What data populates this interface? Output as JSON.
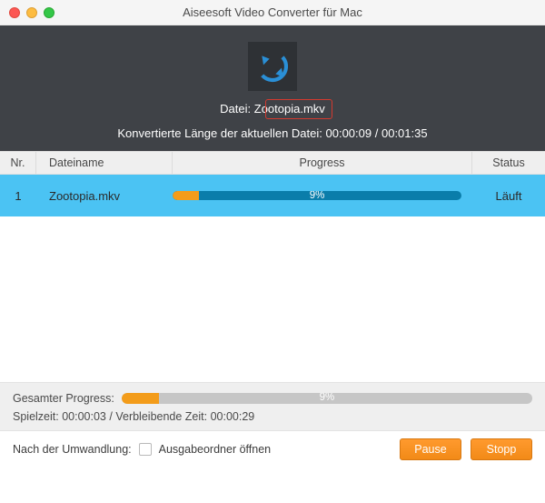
{
  "window": {
    "title": "Aiseesoft Video Converter für Mac"
  },
  "hero": {
    "file_label": "Datei:",
    "file_name": "Zootopia.mkv",
    "conv_prefix": "Konvertierte Länge der aktuellen Datei:",
    "conv_current": "00:00:09",
    "conv_sep": "/",
    "conv_total": "00:01:35"
  },
  "columns": {
    "nr": "Nr.",
    "name": "Dateiname",
    "progress": "Progress",
    "status": "Status"
  },
  "rows": [
    {
      "nr": "1",
      "name": "Zootopia.mkv",
      "pct": "9%",
      "pct_width": "9%",
      "status": "Läuft"
    }
  ],
  "summary": {
    "label": "Gesamter Progress:",
    "pct": "9%",
    "pct_width": "9%",
    "time_line_prefix": "Spielzeit:",
    "elapsed": "00:00:03",
    "sep": "/",
    "remain_label": "Verbleibende Zeit:",
    "remaining": "00:00:29"
  },
  "footer": {
    "after_label": "Nach der Umwandlung:",
    "checkbox_label": "Ausgabeordner öffnen",
    "pause": "Pause",
    "stop": "Stopp"
  },
  "colors": {
    "accent": "#f39c1a",
    "row_bg": "#4bc3f3",
    "hero_bg": "#3f4247"
  }
}
